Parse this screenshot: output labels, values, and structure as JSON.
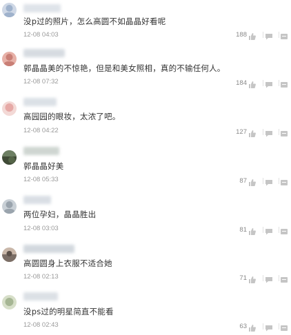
{
  "comments": [
    {
      "text": "没p过的照片，怎么高圆不如晶晶好看呢",
      "time": "12-08 04:03",
      "likes": "188",
      "avatar_colors": [
        "#cfd8e6",
        "#9fb2cc"
      ],
      "name_blur_color": "#d4dae2"
    },
    {
      "text": "郭晶晶美的不惊艳，但是和美女照相，真的不输任何人。",
      "time": "12-08 07:32",
      "likes": "184",
      "avatar_colors": [
        "#e7b1a8",
        "#c97f76"
      ],
      "name_blur_color": "#c9d0d8"
    },
    {
      "text": "高园园的眼妆，太浓了吧。",
      "time": "12-08 04:22",
      "likes": "127",
      "avatar_colors": [
        "#e6a9a6",
        "#f3d9d6"
      ],
      "name_blur_color": "#cfd6de"
    },
    {
      "text": "郭晶晶好美",
      "time": "12-08 05:33",
      "likes": "87",
      "avatar_colors": [
        "#6d7f63",
        "#3f4a36"
      ],
      "name_blur_color": "#bfc8c2"
    },
    {
      "text": "两位孕妇，晶晶胜出",
      "time": "12-08 03:03",
      "likes": "81",
      "avatar_colors": [
        "#c9d0d6",
        "#9aa4ad"
      ],
      "name_blur_color": "#cdd4dc"
    },
    {
      "text": "高圆圆身上衣服不适合她",
      "time": "12-08 02:13",
      "likes": "71",
      "avatar_colors": [
        "#7b6e66",
        "#c9b7a9"
      ],
      "name_blur_color": "#c4ccd4"
    },
    {
      "text": "没ps过的明星简直不能看",
      "time": "12-08 02:43",
      "likes": "63",
      "avatar_colors": [
        "#a6b694",
        "#d7dfc9"
      ],
      "name_blur_color": "#d0d6dd"
    }
  ],
  "icons": {
    "like": "thumbs-up-icon",
    "reply": "reply-icon",
    "more": "more-icon"
  }
}
